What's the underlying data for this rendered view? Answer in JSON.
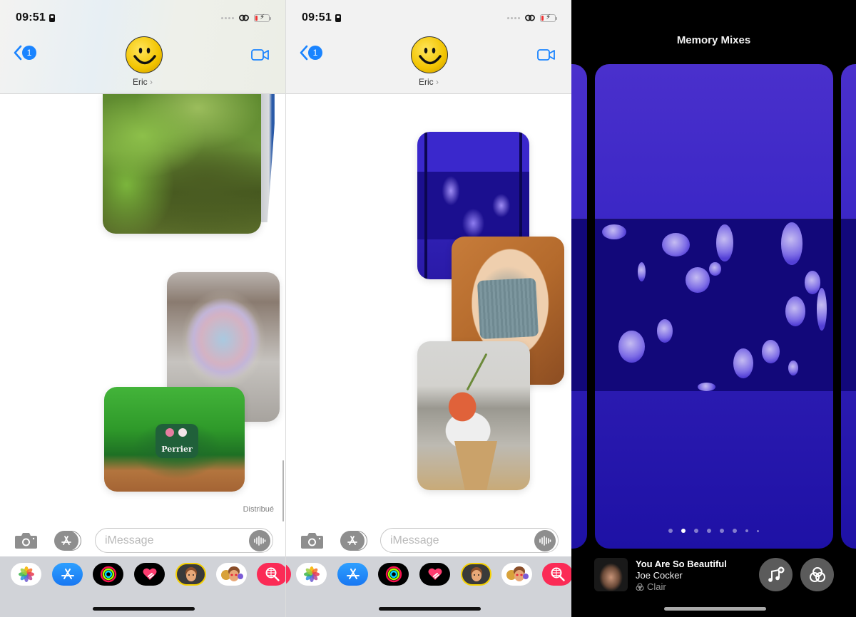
{
  "screens": [
    {
      "status": {
        "time": "09:51"
      },
      "header": {
        "back_badge": "1",
        "contact_name": "Eric",
        "contact_chevron": "›"
      },
      "thread": {
        "delivered_label": "Distribué"
      },
      "input": {
        "placeholder": "iMessage",
        "value": ""
      }
    },
    {
      "status": {
        "time": "09:51"
      },
      "header": {
        "back_badge": "1",
        "contact_name": "Eric",
        "contact_chevron": "›"
      },
      "input": {
        "placeholder": "iMessage",
        "value": ""
      }
    }
  ],
  "app_drawer": [
    {
      "name": "Photos",
      "icon": "photos-icon"
    },
    {
      "name": "App Store",
      "icon": "app-store-icon"
    },
    {
      "name": "Fitness",
      "icon": "activity-rings-icon"
    },
    {
      "name": "Digital Touch",
      "icon": "heart-icon"
    },
    {
      "name": "Memoji",
      "icon": "memoji-icon"
    },
    {
      "name": "Memoji Stickers",
      "icon": "memoji-stickers-icon"
    },
    {
      "name": "Images",
      "icon": "image-search-icon"
    }
  ],
  "memory_mixes": {
    "title": "Memory Mixes",
    "pages_total": 8,
    "current_page": 2,
    "now_playing": {
      "title": "You Are So Beautiful",
      "artist": "Joe Cocker",
      "filter": "Clair"
    },
    "colors": {
      "accent_blue": "#1a84ff",
      "card_blue": "#3b27c6"
    }
  }
}
